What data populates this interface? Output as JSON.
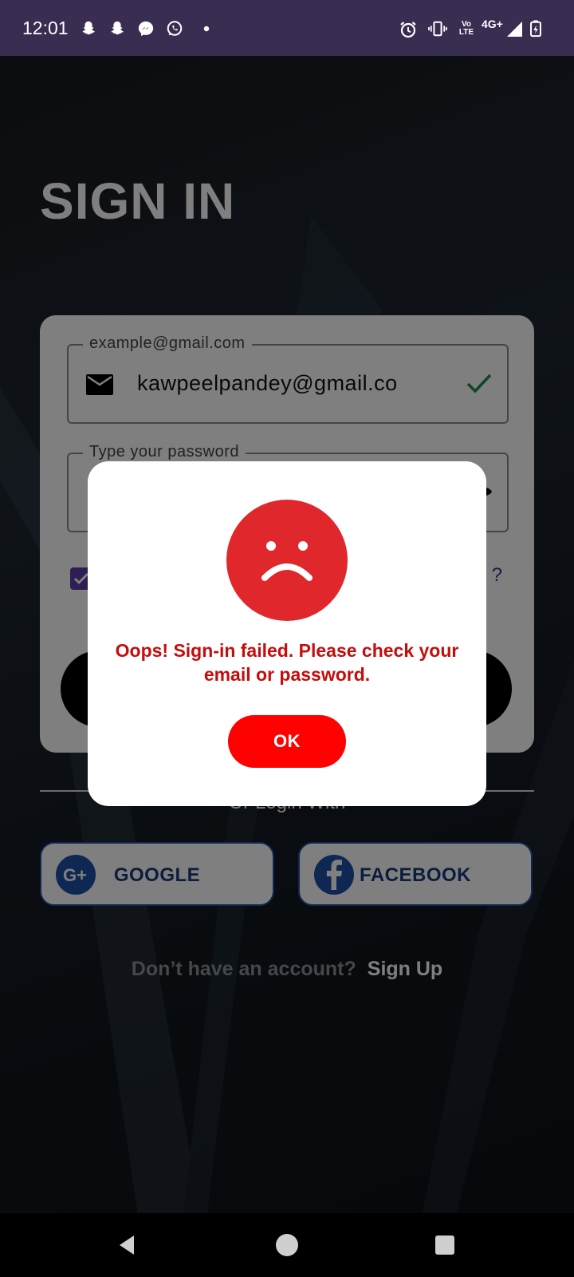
{
  "status_bar": {
    "time": "12:01",
    "notification_icons": [
      "snapchat-icon",
      "snapchat-icon",
      "messenger-icon",
      "whatsapp-icon",
      "dot-icon"
    ],
    "system_icons": [
      "alarm-icon",
      "vibrate-icon",
      "volte-icon",
      "signal-icon",
      "battery-charging-icon"
    ],
    "network_label": "4G+",
    "volte_label": "Vo LTE"
  },
  "page": {
    "title": "SIGN IN"
  },
  "form": {
    "email_placeholder": "example@gmail.com",
    "email_value": "kawpeelpandey@gmail.co",
    "password_placeholder": "Type your password",
    "forgot_partial": "?"
  },
  "social": {
    "divider_text": "Or Login With",
    "google_label": "GOOGLE",
    "facebook_label": "FACEBOOK"
  },
  "signup": {
    "prompt": "Don’t have an account?",
    "link": "Sign Up"
  },
  "dialog": {
    "message": "Oops! Sign-in failed. Please check your email or password.",
    "ok_label": "OK"
  },
  "colors": {
    "status_bar": "#3a2d52",
    "dialog_red": "#fe0202",
    "message_red": "#c40d0d",
    "face_red": "#e0272b",
    "social_border": "#1f4fa6",
    "checkbox": "#5b3ea6"
  }
}
